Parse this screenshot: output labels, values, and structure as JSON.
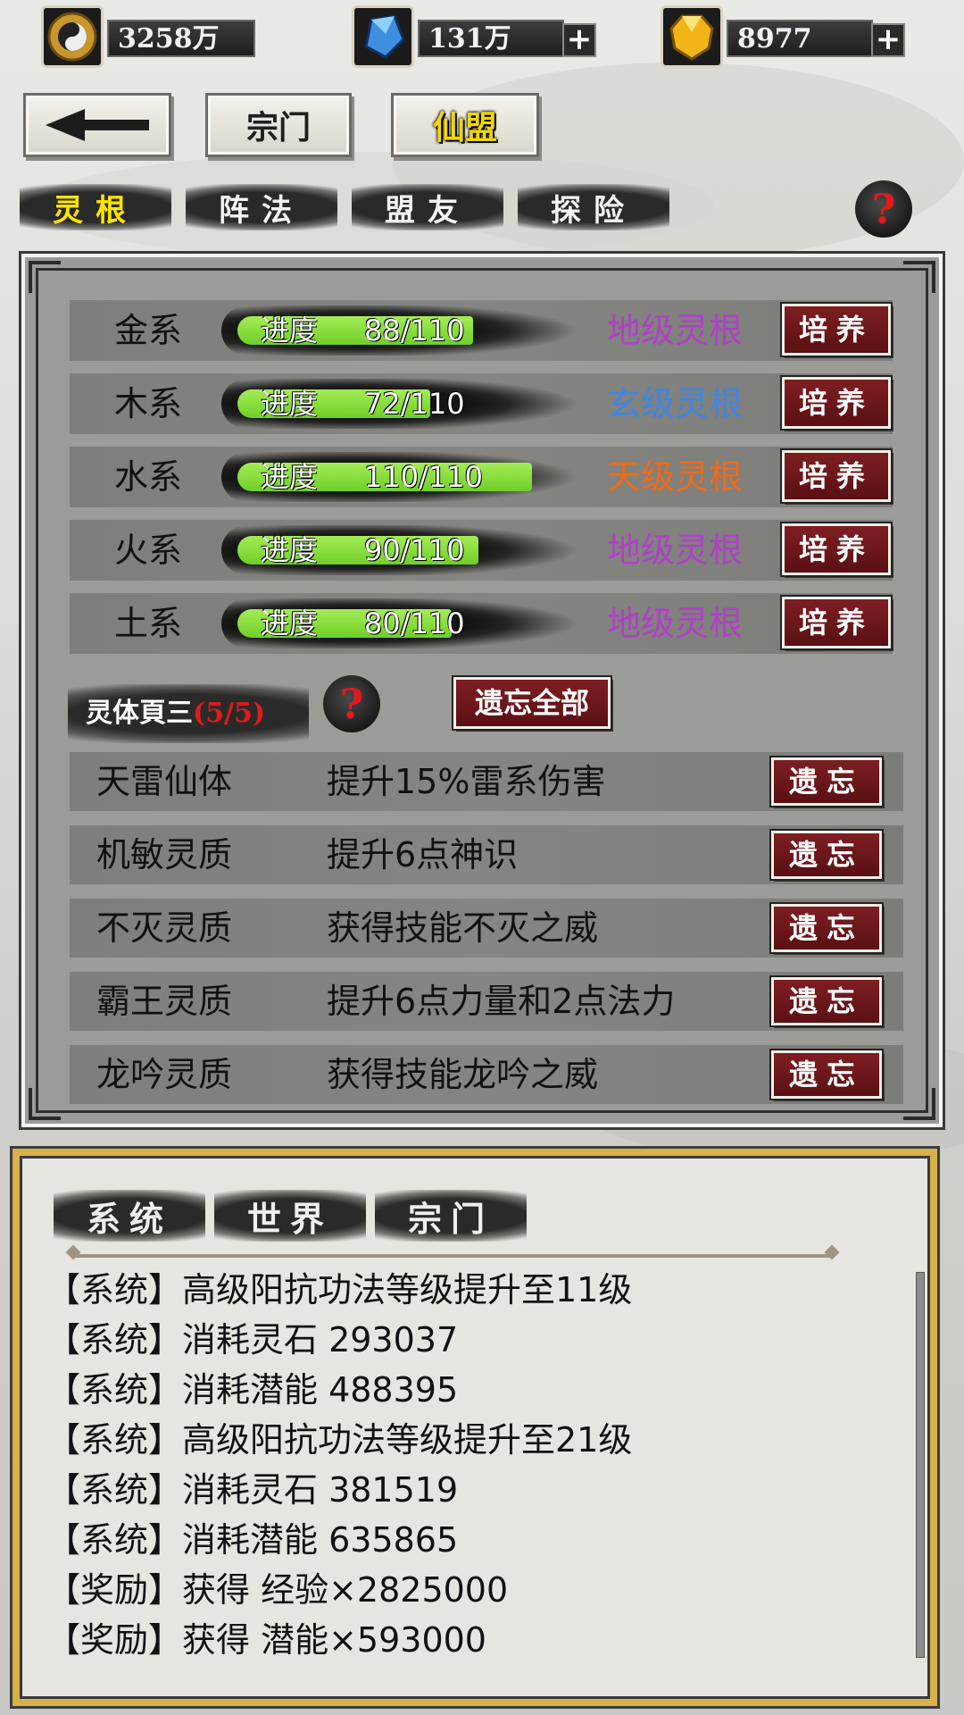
{
  "resources": [
    {
      "icon": "yin-yang-coin-icon",
      "value": "3258万",
      "has_plus": false
    },
    {
      "icon": "blue-crystal-icon",
      "value": "131万",
      "has_plus": true
    },
    {
      "icon": "gold-gem-icon",
      "value": "8977",
      "has_plus": true
    }
  ],
  "plus_label": "+",
  "nav": {
    "back_icon": "back-arrow-icon",
    "sect": "宗门",
    "alliance": "仙盟"
  },
  "tabs": {
    "root": "灵根",
    "formation": "阵法",
    "allies": "盟友",
    "explore": "探险"
  },
  "help_label": "?",
  "progress_label": "进度",
  "cultivate_label": "培养",
  "forget_label": "遗忘",
  "elements": [
    {
      "name": "金系",
      "value": "88/110",
      "progress": 0.8,
      "grade": "地级灵根",
      "grade_color": "#b040c8"
    },
    {
      "name": "木系",
      "value": "72/110",
      "progress": 0.6545,
      "grade": "玄级灵根",
      "grade_color": "#3f86e6"
    },
    {
      "name": "水系",
      "value": "110/110",
      "progress": 1.0,
      "grade": "天级灵根",
      "grade_color": "#f06a18"
    },
    {
      "name": "火系",
      "value": "90/110",
      "progress": 0.818,
      "grade": "地级灵根",
      "grade_color": "#b040c8"
    },
    {
      "name": "土系",
      "value": "80/110",
      "progress": 0.727,
      "grade": "地级灵根",
      "grade_color": "#b040c8"
    }
  ],
  "traits_header": {
    "title": "灵体頁三",
    "count": "(5/5)",
    "forget_all": "遗忘全部"
  },
  "traits": [
    {
      "name": "天雷仙体",
      "desc": "提升15%雷系伤害"
    },
    {
      "name": "机敏灵质",
      "desc": "提升6点神识"
    },
    {
      "name": "不灭灵质",
      "desc": "获得技能不灭之威"
    },
    {
      "name": "霸王灵质",
      "desc": "提升6点力量和2点法力"
    },
    {
      "name": "龙吟灵质",
      "desc": "获得技能龙吟之威"
    }
  ],
  "chat": {
    "tabs": [
      "系统",
      "世界",
      "宗门"
    ],
    "lines": [
      "【系统】高级阳抗功法等级提升至11级",
      "【系统】消耗灵石 293037",
      "【系统】消耗潜能 488395",
      "【系统】高级阳抗功法等级提升至21级",
      "【系统】消耗灵石 381519",
      "【系统】消耗潜能 635865",
      "【奖励】获得 经验×2825000",
      "【奖励】获得 潜能×593000"
    ]
  },
  "colors": {
    "accent_yellow": "#ffe600",
    "button_red": "#6e1a1e",
    "help_red": "#e01a1a",
    "progress_green": "#8fe040",
    "frame_gold": "#d8b04c"
  }
}
